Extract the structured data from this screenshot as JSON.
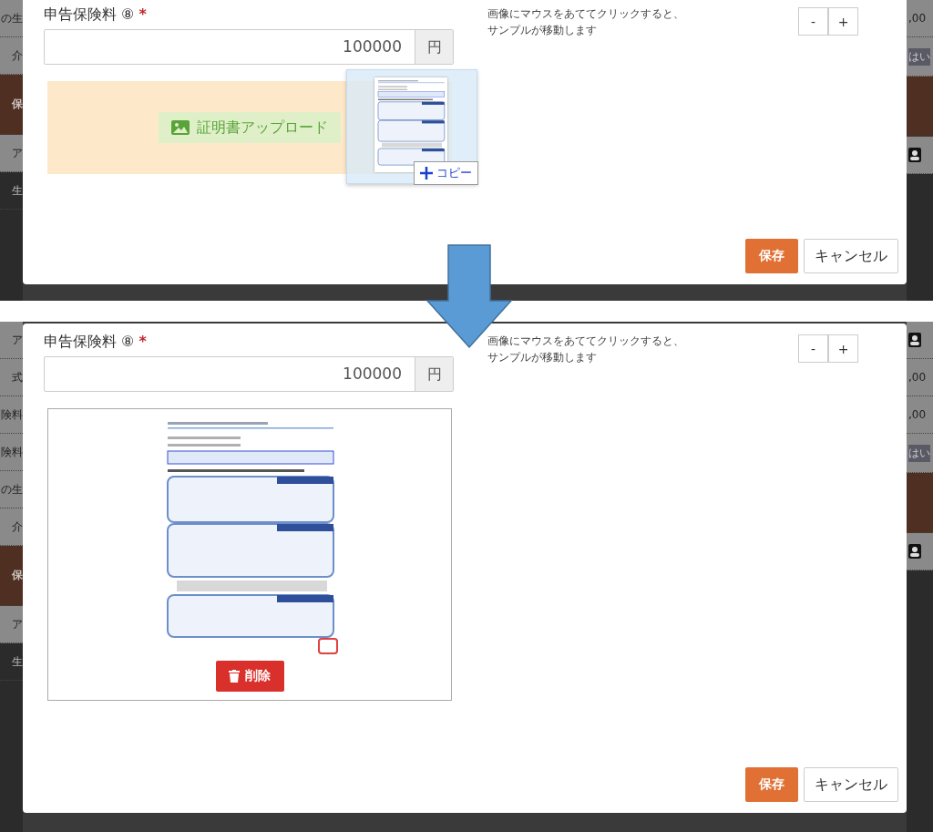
{
  "panels": [
    {
      "kind": "upload",
      "backdrop": {
        "left": [
          {
            "kind": "light",
            "text": "の生"
          },
          {
            "kind": "light",
            "text": "介"
          },
          {
            "kind": "band",
            "text": "保"
          },
          {
            "kind": "light",
            "text": "ア"
          },
          {
            "kind": "dark",
            "text": "生"
          }
        ],
        "right": [
          {
            "kind": "light",
            "text": ",00"
          },
          {
            "kind": "badge",
            "text": "はい"
          },
          {
            "kind": "band"
          },
          {
            "kind": "icon"
          }
        ]
      },
      "field": {
        "label": "申告保険料",
        "number": "⑧",
        "required_mark": "*",
        "value": "100000",
        "unit": "円"
      },
      "upload_button": "証明書アップロード",
      "drag_badge": "コピー",
      "hint_lines": [
        "画像にマウスをあててクリックすると、",
        "サンプルが移動します"
      ],
      "zoom_buttons": [
        "-",
        "+"
      ],
      "save": "保存",
      "cancel": "キャンセル"
    },
    {
      "kind": "preview",
      "backdrop": {
        "left": [
          {
            "kind": "light",
            "text": "ア"
          },
          {
            "kind": "light",
            "text": "式"
          },
          {
            "kind": "light",
            "text": "険料"
          },
          {
            "kind": "light",
            "text": "険料"
          },
          {
            "kind": "light",
            "text": "の生"
          },
          {
            "kind": "light",
            "text": "介"
          },
          {
            "kind": "band",
            "text": "保"
          },
          {
            "kind": "light",
            "text": "ア"
          },
          {
            "kind": "dark",
            "text": "生"
          }
        ],
        "right": [
          {
            "kind": "icon"
          },
          {
            "kind": "light",
            "text": ",00"
          },
          {
            "kind": "light",
            "text": ",00"
          },
          {
            "kind": "badge",
            "text": "はい"
          },
          {
            "kind": "band"
          },
          {
            "kind": "icon"
          }
        ]
      },
      "field": {
        "label": "申告保険料",
        "number": "⑧",
        "required_mark": "*",
        "value": "100000",
        "unit": "円"
      },
      "delete_button": "削除",
      "hint_lines": [
        "画像にマウスをあててクリックすると、",
        "サンプルが移動します"
      ],
      "zoom_buttons": [
        "-",
        "+"
      ],
      "save": "保存",
      "cancel": "キャンセル"
    }
  ]
}
